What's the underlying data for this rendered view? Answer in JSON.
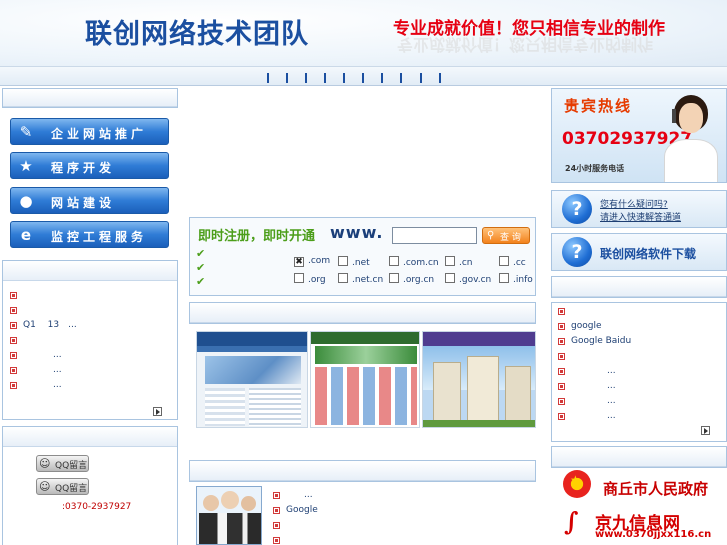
{
  "header": {
    "logo_text": "联创网络技术团队",
    "slogan": "专业成就价值！您只相信专业的制作",
    "nav_separator_count": 10
  },
  "left_menu": {
    "buttons": [
      {
        "label": "企业网站推广",
        "icon": "wrench-icon"
      },
      {
        "label": "程序开发",
        "icon": "star-icon"
      },
      {
        "label": "网站建设",
        "icon": "user-icon"
      },
      {
        "label": "监控工程服务",
        "icon": "ie-icon"
      }
    ]
  },
  "left_news": {
    "items": [
      "",
      "",
      "Q1　 13　...",
      "",
      "...",
      "...",
      "..."
    ]
  },
  "left_contact": {
    "qq_buttons": [
      "QQ留言",
      "QQ留言"
    ],
    "phone": ":0370-2937927"
  },
  "domain": {
    "register_title": "即时注册，即时开通",
    "www_label": "www.",
    "input_value": "",
    "query_label": "查 询",
    "tlds": [
      {
        "ext": ".com",
        "checked": true
      },
      {
        "ext": ".net",
        "checked": false
      },
      {
        "ext": ".com.cn",
        "checked": false
      },
      {
        "ext": ".cn",
        "checked": false
      },
      {
        "ext": ".cc",
        "checked": false
      },
      {
        "ext": ".org",
        "checked": false
      },
      {
        "ext": ".net.cn",
        "checked": false
      },
      {
        "ext": ".org.cn",
        "checked": false
      },
      {
        "ext": ".gov.cn",
        "checked": false
      },
      {
        "ext": ".info",
        "checked": false
      }
    ]
  },
  "center_bottom": {
    "items": [
      "　　...",
      "Google",
      "",
      ""
    ]
  },
  "right": {
    "hotline": {
      "title": "贵宾热线",
      "phone": "03702937927",
      "subtitle": "24小时服务电话"
    },
    "faq": {
      "line1": "您有什么疑问吗?",
      "line2": "请进入快速解答通道"
    },
    "download_label": "联创网络软件下载",
    "links": [
      "",
      "google",
      "Google Baidu",
      "",
      "...",
      "...",
      "...",
      "..."
    ],
    "gov_label": "商丘市人民政府",
    "jiujiu_label": "京九信息网",
    "jiujiu_url": "www.0370jjxx116.cn"
  },
  "colors": {
    "brand_blue": "#1b4fa0",
    "slogan_red": "#e60012",
    "register_green": "#4c9e1a",
    "panel_border": "#a9c4e0"
  }
}
